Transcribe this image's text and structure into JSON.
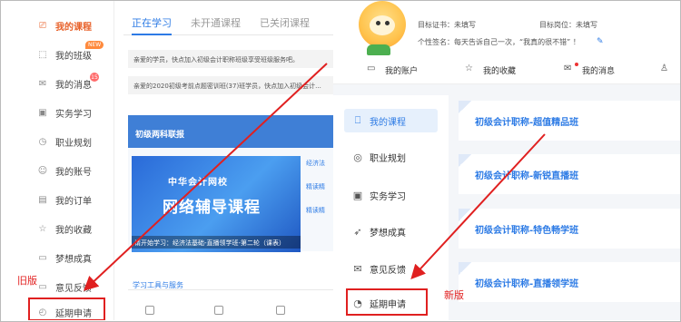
{
  "old_version": {
    "sidebar": [
      {
        "label": "我的课程",
        "icon": "monitor-icon",
        "glyph": "⎚",
        "active": true
      },
      {
        "label": "我的班级",
        "icon": "class-icon",
        "glyph": "⬚",
        "badge": "NEW"
      },
      {
        "label": "我的消息",
        "icon": "mail-icon",
        "glyph": "✉",
        "count": "15"
      },
      {
        "label": "实务学习",
        "icon": "practice-icon",
        "glyph": "▣"
      },
      {
        "label": "职业规划",
        "icon": "plan-icon",
        "glyph": "◷"
      },
      {
        "label": "我的账号",
        "icon": "user-icon",
        "glyph": "☺"
      },
      {
        "label": "我的订单",
        "icon": "order-icon",
        "glyph": "▤"
      },
      {
        "label": "我的收藏",
        "icon": "star-icon",
        "glyph": "☆"
      },
      {
        "label": "梦想成真",
        "icon": "dream-icon",
        "glyph": "▭"
      },
      {
        "label": "意见反馈",
        "icon": "feedback-icon",
        "glyph": "▭"
      },
      {
        "label": "延期申请",
        "icon": "clock-icon",
        "glyph": "◴"
      }
    ],
    "tabs": [
      "正在学习",
      "未开通课程",
      "已关闭课程"
    ],
    "notices": [
      "亲爱的学员，快点加入初级会计职称班级享受班级服务吧。",
      "亲爱的2020初级考前点题密训班(37)班学员，快点加入初级会计..."
    ],
    "promo": {
      "header": "初级两科联报",
      "brand": "中华会计网校",
      "title": "网络辅导课程",
      "caption": "请开始学习：经济法基础-直播领学班-第二轮（课表）",
      "links": [
        "经济法",
        "精读精",
        "精读精"
      ]
    },
    "tools_title": "学习工具与服务",
    "tool_count": 3,
    "label": "旧版"
  },
  "new_version": {
    "header": {
      "avatar": "avatar-cartoon",
      "target_cert": "目标证书：未填写",
      "target_job": "目标岗位：未填写",
      "signature": "个性签名：每天告诉自己一次，“我真的很不错” ！",
      "quick_links": [
        {
          "label": "我的账户",
          "icon": "wallet-icon",
          "glyph": "▭"
        },
        {
          "label": "我的收藏",
          "icon": "star-icon",
          "glyph": "☆"
        },
        {
          "label": "我的消息",
          "icon": "message-icon",
          "glyph": "✉"
        }
      ],
      "profile_icon": "profile-icon"
    },
    "sidebar": [
      {
        "label": "我的课程",
        "icon": "bookmark-icon",
        "glyph": "⎕",
        "active": true
      },
      {
        "label": "职业规划",
        "icon": "plan-icon",
        "glyph": "◎"
      },
      {
        "label": "实务学习",
        "icon": "practice-icon",
        "glyph": "▣"
      },
      {
        "label": "梦想成真",
        "icon": "rocket-icon",
        "glyph": "➶"
      },
      {
        "label": "意见反馈",
        "icon": "mail-icon",
        "glyph": "✉"
      },
      {
        "label": "延期申请",
        "icon": "clock-icon",
        "glyph": "◔"
      }
    ],
    "courses": [
      "初级会计职称-超值精品班",
      "初级会计职称-新锐直播班",
      "初级会计职称-特色畅学班",
      "初级会计职称-直播领学班"
    ],
    "label": "新版"
  },
  "colors": {
    "accent_blue": "#2d7be5",
    "accent_orange": "#e8622b",
    "annotation_red": "#e02020"
  }
}
